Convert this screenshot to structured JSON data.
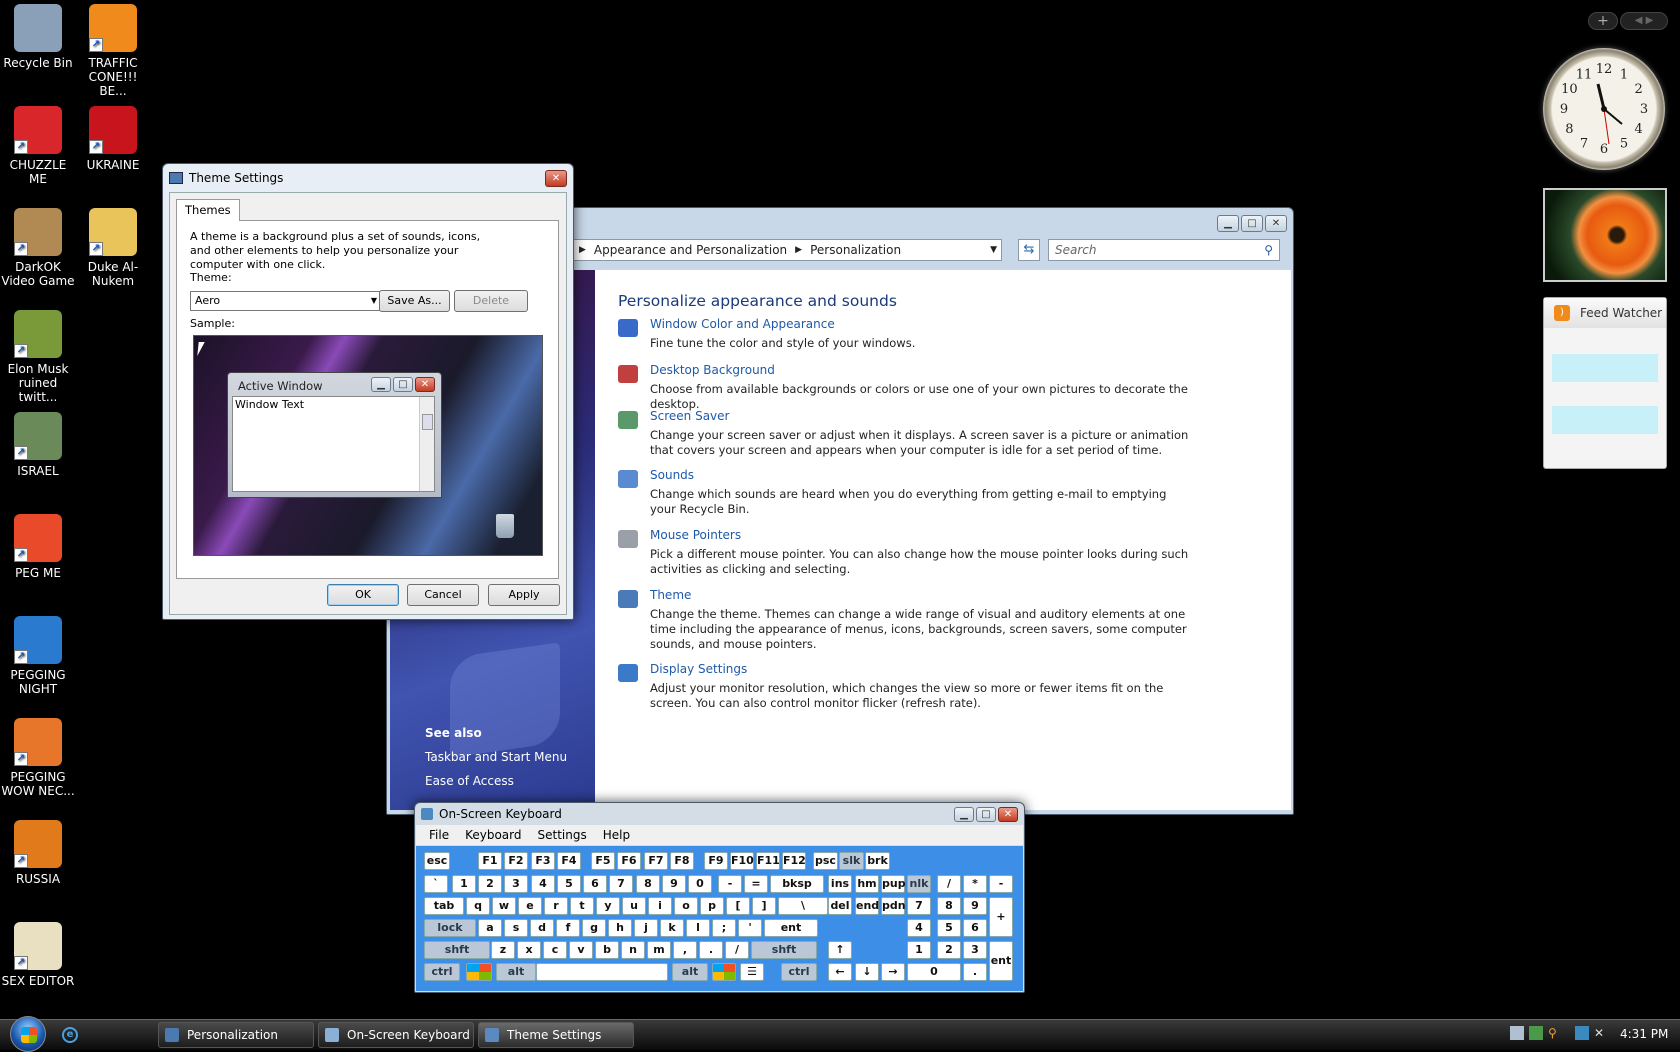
{
  "desktop": {
    "icons": [
      {
        "label": "Recycle Bin",
        "icon": "recycle-bin-icon",
        "color": "#8aa0b8"
      },
      {
        "label": "TRAFFIC CONE!!! BE...",
        "icon": "traffic-cone-icon",
        "color": "#f08a1c"
      },
      {
        "label": "CHUZZLE ME",
        "icon": "chuzzle-icon",
        "color": "#d8262a"
      },
      {
        "label": "UKRAINE",
        "icon": "radiation-icon",
        "color": "#c8141c"
      },
      {
        "label": "DarkOK Video Game",
        "icon": "money-bag-icon",
        "color": "#b08a52"
      },
      {
        "label": "Duke Al-Nukem",
        "icon": "folder-icon",
        "color": "#e8c45a"
      },
      {
        "label": "Elon Musk ruined twitt...",
        "icon": "box-character-icon",
        "color": "#7a9a3a"
      },
      {
        "label": "ISRAEL",
        "icon": "flower-icon",
        "color": "#6a8a5a"
      },
      {
        "label": "PEG ME",
        "icon": "peggle-icon",
        "color": "#e84a2a"
      },
      {
        "label": "PEGGING NIGHT",
        "icon": "peggle-night-icon",
        "color": "#2a7ad0"
      },
      {
        "label": "PEGGING WOW NEC...",
        "icon": "peggle-icon",
        "color": "#e8762a"
      },
      {
        "label": "RUSSIA",
        "icon": "russia-icon",
        "color": "#e07a1a"
      },
      {
        "label": "SEX EDITOR",
        "icon": "hxd-editor-icon",
        "color": "#e8e0c0"
      }
    ]
  },
  "theme_dialog": {
    "title": "Theme Settings",
    "tab": "Themes",
    "description": "A theme is a background plus a set of sounds, icons, and other elements to help you personalize your computer with one click.",
    "theme_label": "Theme:",
    "theme_value": "Aero",
    "save_as": "Save As...",
    "delete": "Delete",
    "sample_label": "Sample:",
    "sample_window_title": "Active Window",
    "sample_window_text": "Window Text",
    "ok": "OK",
    "cancel": "Cancel",
    "apply": "Apply"
  },
  "personalization": {
    "breadcrumb": [
      "Appearance and Personalization",
      "Personalization"
    ],
    "search_placeholder": "Search",
    "heading": "Personalize appearance and sounds",
    "items": [
      {
        "title": "Window Color and Appearance",
        "desc": "Fine tune the color and style of your windows.",
        "icon": "window-color-icon"
      },
      {
        "title": "Desktop Background",
        "desc": "Choose from available backgrounds or colors or use one of your own pictures to decorate the desktop.",
        "icon": "desktop-background-icon"
      },
      {
        "title": "Screen Saver",
        "desc": "Change your screen saver or adjust when it displays. A screen saver is a picture or animation that covers your screen and appears when your computer is idle for a set period of time.",
        "icon": "screen-saver-icon"
      },
      {
        "title": "Sounds",
        "desc": "Change which sounds are heard when you do everything from getting e-mail to emptying your Recycle Bin.",
        "icon": "sounds-icon"
      },
      {
        "title": "Mouse Pointers",
        "desc": "Pick a different mouse pointer. You can also change how the mouse pointer looks during such activities as clicking and selecting.",
        "icon": "mouse-icon"
      },
      {
        "title": "Theme",
        "desc": "Change the theme. Themes can change a wide range of visual and auditory elements at one time including the appearance of menus, icons, backgrounds, screen savers, some computer sounds, and mouse pointers.",
        "icon": "theme-icon"
      },
      {
        "title": "Display Settings",
        "desc": "Adjust your monitor resolution, which changes the view so more or fewer items fit on the screen. You can also control monitor flicker (refresh rate).",
        "icon": "display-icon"
      }
    ],
    "see_also": "See also",
    "see_also_links": [
      "Taskbar and Start Menu",
      "Ease of Access"
    ]
  },
  "osk": {
    "title": "On-Screen Keyboard",
    "menu": [
      "File",
      "Keyboard",
      "Settings",
      "Help"
    ],
    "rows": {
      "r1": [
        "esc",
        "F1",
        "F2",
        "F3",
        "F4",
        "F5",
        "F6",
        "F7",
        "F8",
        "F9",
        "F10",
        "F11",
        "F12",
        "psc",
        "slk",
        "brk"
      ],
      "r2": [
        "`",
        "1",
        "2",
        "3",
        "4",
        "5",
        "6",
        "7",
        "8",
        "9",
        "0",
        "-",
        "=",
        "bksp",
        "ins",
        "hm",
        "pup",
        "nlk",
        "/",
        "*",
        "-"
      ],
      "r3": [
        "tab",
        "q",
        "w",
        "e",
        "r",
        "t",
        "y",
        "u",
        "i",
        "o",
        "p",
        "[",
        "]",
        "\\",
        "del",
        "end",
        "pdn",
        "7",
        "8",
        "9",
        "+"
      ],
      "r4": [
        "lock",
        "a",
        "s",
        "d",
        "f",
        "g",
        "h",
        "j",
        "k",
        "l",
        ";",
        "'",
        "ent",
        "4",
        "5",
        "6"
      ],
      "r5": [
        "shft",
        "z",
        "x",
        "c",
        "v",
        "b",
        "n",
        "m",
        ",",
        ".",
        "/",
        "shft",
        "↑",
        "1",
        "2",
        "3",
        "ent"
      ],
      "r6": [
        "ctrl",
        "alt",
        "alt",
        "ctrl",
        "←",
        "↓",
        "→",
        "0",
        "."
      ]
    }
  },
  "gadgets": {
    "feed_title": "Feed Watcher",
    "clock_numbers": [
      "12",
      "1",
      "2",
      "3",
      "4",
      "5",
      "6",
      "7",
      "8",
      "9",
      "10",
      "11"
    ]
  },
  "taskbar": {
    "items": [
      "Personalization",
      "On-Screen Keyboard",
      "Theme Settings"
    ],
    "time": "4:31 PM"
  }
}
